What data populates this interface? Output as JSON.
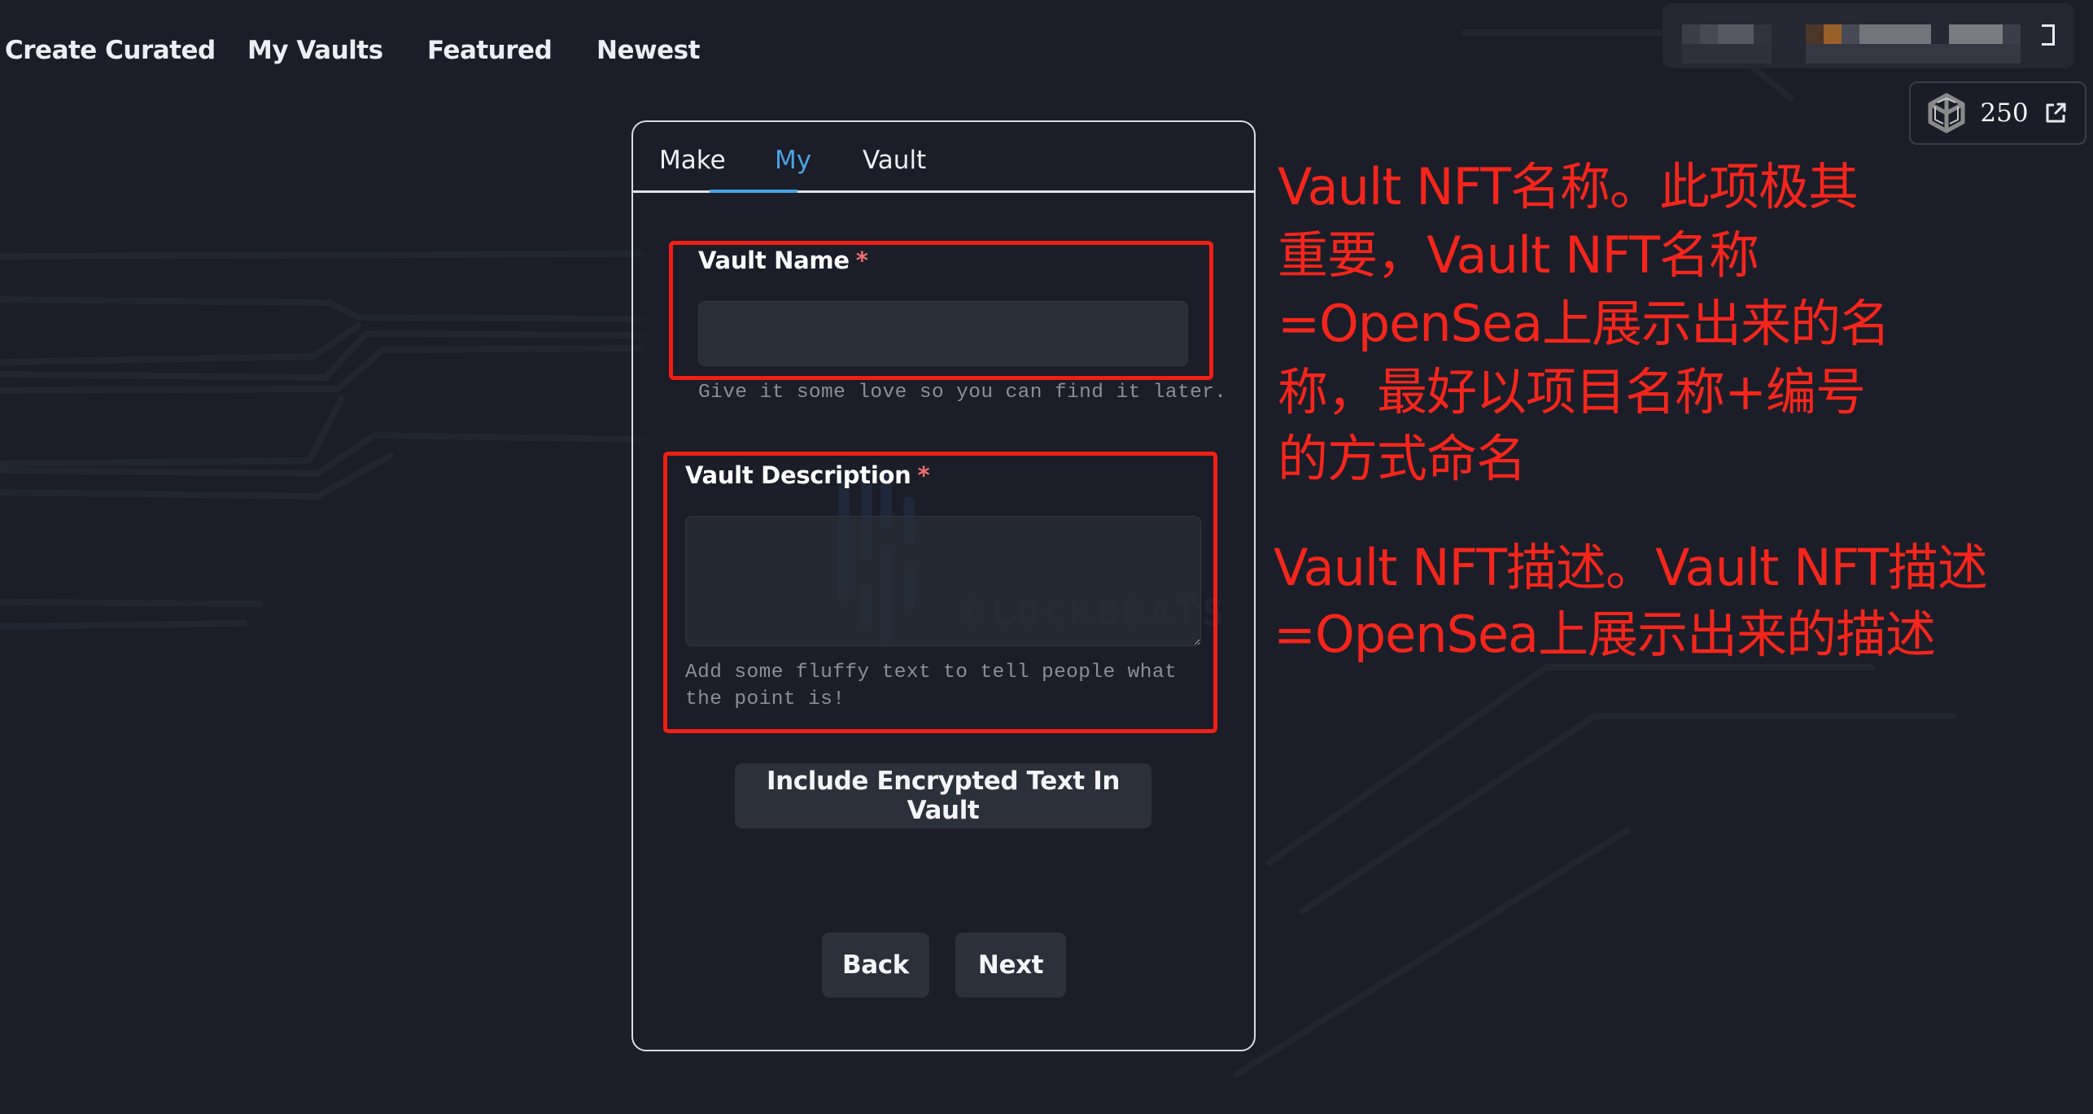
{
  "nav": {
    "items": [
      "Create Curated",
      "My Vaults",
      "Featured",
      "Newest"
    ]
  },
  "account": {
    "blurred": true,
    "points": "250",
    "points_icon": "cube-logo-icon",
    "link_icon": "external-link-icon",
    "expand_icon": "expand-icon"
  },
  "card": {
    "tabs": [
      {
        "label": "Make",
        "active": false
      },
      {
        "label": "My",
        "active": true
      },
      {
        "label": "Vault",
        "active": false
      }
    ],
    "vault_name": {
      "label": "Vault Name",
      "required_mark": "*",
      "value": "",
      "placeholder": "",
      "hint": "Give it some love so you can find it later."
    },
    "vault_description": {
      "label": "Vault Description",
      "required_mark": "*",
      "value": "",
      "placeholder": "",
      "hint": "Add some fluffy text to tell people what the point is!"
    },
    "include_encrypted_label": "Include Encrypted Text In Vault",
    "back_label": "Back",
    "next_label": "Next"
  },
  "watermark": "BLOCKBEATS",
  "annotations": {
    "name_note": [
      "Vault NFT名称。此项极其",
      "重要，Vault NFT名称",
      "=OpenSea上展示出来的名",
      "称，最好以项目名称+编号",
      "的方式命名"
    ],
    "description_note": [
      "Vault NFT描述。Vault NFT描述",
      "=OpenSea上展示出来的描述"
    ]
  },
  "colors": {
    "background": "#1b1e28",
    "accent_blue": "#4ba3e3",
    "annotation_red": "#f4251c",
    "required_star": "#f07070",
    "button_bg": "#2c303b"
  }
}
